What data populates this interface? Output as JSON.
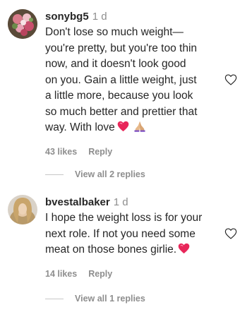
{
  "comments": [
    {
      "username": "sonybg5",
      "time": "1 d",
      "lines": [
        "Don't lose so much weight—",
        "you're pretty, but you're too thin",
        "now, and it doesn't look good",
        "on you. Gain a little weight, just",
        "a little more, because you look",
        "so much better and prettier that",
        "way. With love"
      ],
      "emojis": [
        "pink-heart",
        "praying-hands"
      ],
      "likes": "43 likes",
      "reply_label": "Reply",
      "view_replies": "View all 2 replies"
    },
    {
      "username": "bvestalbaker",
      "time": "1 d",
      "lines": [
        "I hope the weight loss is for your",
        "next role. If not you need some",
        "meat on those bones girlie."
      ],
      "emojis": [
        "pink-heart"
      ],
      "likes": "14 likes",
      "reply_label": "Reply",
      "view_replies": "View all 1 replies"
    }
  ],
  "colors": {
    "text": "#262626",
    "secondary": "#8e8e8e",
    "heart": "#e8275a"
  },
  "icons": {
    "like": "heart-outline-icon"
  }
}
